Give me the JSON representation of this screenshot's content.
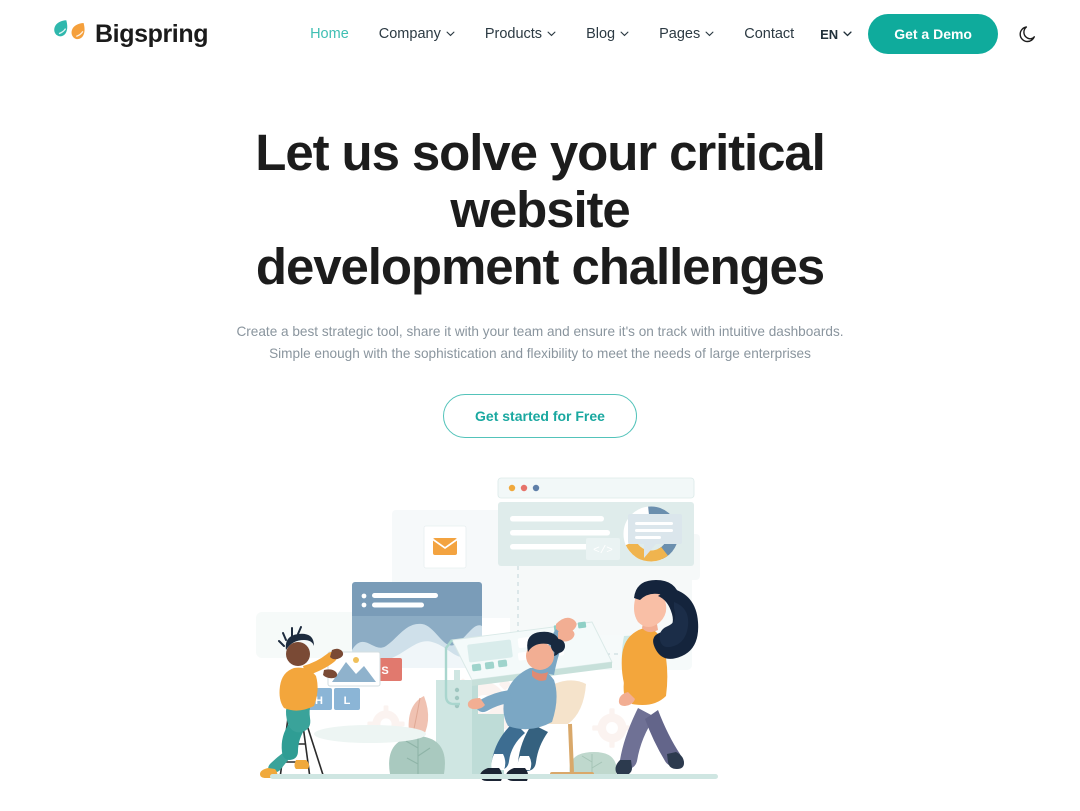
{
  "brand": {
    "name": "Bigspring",
    "mark_icon": "two-leaf-logo-icon",
    "mark_teal": "#2fb8ad",
    "mark_orange": "#f5a03c"
  },
  "nav": {
    "items": [
      {
        "label": "Home",
        "has_dropdown": false,
        "active": true,
        "icon": ""
      },
      {
        "label": "Company",
        "has_dropdown": true,
        "active": false,
        "icon": "chevron-down-icon"
      },
      {
        "label": "Products",
        "has_dropdown": true,
        "active": false,
        "icon": "chevron-down-icon"
      },
      {
        "label": "Blog",
        "has_dropdown": true,
        "active": false,
        "icon": "chevron-down-icon"
      },
      {
        "label": "Pages",
        "has_dropdown": true,
        "active": false,
        "icon": "chevron-down-icon"
      },
      {
        "label": "Contact",
        "has_dropdown": false,
        "active": false,
        "icon": ""
      }
    ]
  },
  "header_right": {
    "language": "EN",
    "language_icon": "chevron-down-icon",
    "demo_button": "Get a Demo",
    "theme_toggle_icon": "moon-icon"
  },
  "hero": {
    "title_line1": "Let us solve your critical website",
    "title_line2": "development challenges",
    "subtitle_line1": "Create a best strategic tool, share it with your team and ensure it's on track with intuitive dashboards.",
    "subtitle_line2": "Simple enough with the sophistication and flexibility to meet the needs of large enterprises",
    "cta_label": "Get started for Free"
  },
  "illustration": {
    "name": "team-collaboration-dashboard-illustration",
    "badges": [
      {
        "label": "S",
        "color": "#e1796e"
      },
      {
        "label": "H",
        "color": "#8bb5d6"
      },
      {
        "label": "L",
        "color": "#8bb5d6"
      }
    ],
    "code_badge": "</>",
    "window_dots": [
      "#f0a93c",
      "#e6736a",
      "#5f7fa8"
    ],
    "elements": [
      "browser-window-card",
      "donut-chart",
      "email-envelope-card",
      "area-chart-panel",
      "speech-bubble",
      "code-badge",
      "person-on-ladder-with-photo",
      "person-seated-on-chair-pointing",
      "person-walking-with-folder",
      "pedestal",
      "plants"
    ]
  },
  "colors": {
    "accent_teal": "#0fab9c",
    "accent_teal_light": "#3fbfb3",
    "text_dark": "#1c1c1c",
    "text_muted": "#8a959e",
    "orange": "#f5a03c",
    "slate_blue": "#6b8fae",
    "mint": "#cfe6e2",
    "sage": "#a9c9bf",
    "salmon": "#e8a79a",
    "navy_hair": "#152b45",
    "skin": "#f2ae93",
    "skin_dark": "#7a4a35",
    "purple_grey": "#6f7195"
  }
}
